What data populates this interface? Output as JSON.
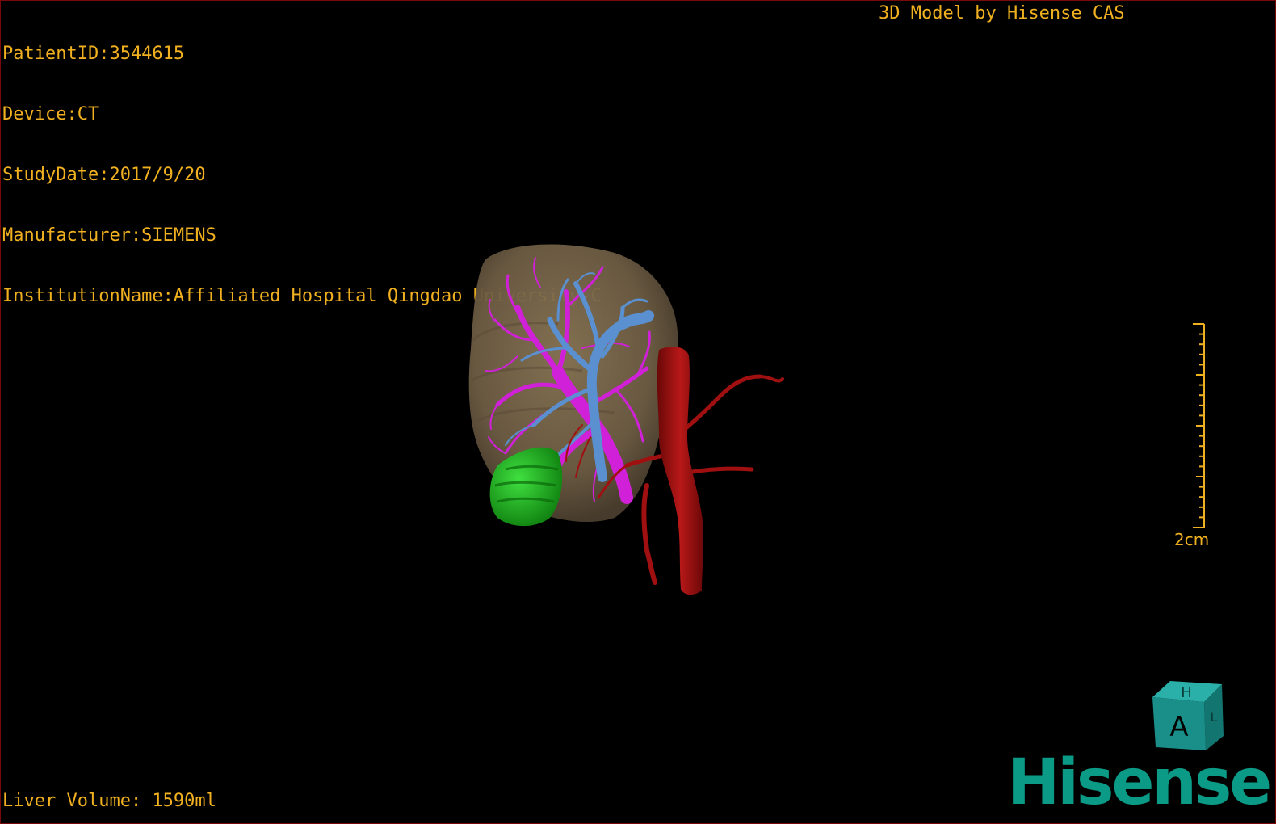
{
  "viewer": {
    "info_lines": [
      "PatientID:3544615",
      "Device:CT",
      "StudyDate:2017/9/20",
      "Manufacturer:SIEMENS",
      "InstitutionName:Affiliated Hospital Qingdao University-C"
    ],
    "model_credit": "3D Model by Hisense CAS",
    "volume_text": "Liver Volume: 1590ml",
    "scale_label": "2cm",
    "brand": "Hisense",
    "orientation_cube": {
      "front_letter": "A",
      "top_letter": "H",
      "side_letter": "L"
    }
  },
  "colors": {
    "overlay_text": "#f0b020",
    "liver": "#7d6a4e",
    "portal_vein": "#d020d8",
    "hepatic_vein": "#5a90d0",
    "artery": "#a01010",
    "tumor": "#18b418",
    "brand": "#0a9a86",
    "cube": "#1a8f8a"
  }
}
